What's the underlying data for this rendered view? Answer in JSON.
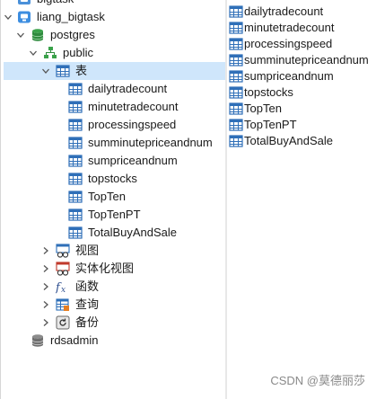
{
  "tree": {
    "top_partial": "bigtask",
    "connection": "liang_bigtask",
    "database": "postgres",
    "schema": "public",
    "tables_folder": "表",
    "tables": [
      "dailytradecount",
      "minutetradecount",
      "processingspeed",
      "summinutepriceandnum",
      "sumpriceandnum",
      "topstocks",
      "TopTen",
      "TopTenPT",
      "TotalBuyAndSale"
    ],
    "folders": [
      "视图",
      "实体化视图",
      "函数",
      "查询",
      "备份"
    ],
    "other_db": "rdsadmin"
  },
  "list": {
    "items": [
      "dailytradecount",
      "minutetradecount",
      "processingspeed",
      "summinutepriceandnum",
      "sumpriceandnum",
      "topstocks",
      "TopTen",
      "TopTenPT",
      "TotalBuyAndSale"
    ]
  },
  "watermark": "CSDN @莫德丽莎",
  "colors": {
    "selection": "#cfe6fb",
    "table_icon": "#2f6fb8",
    "db_icon": "#3aa24a"
  },
  "icons": {
    "table": "table-icon",
    "database": "database-icon",
    "schema": "schema-icon",
    "connection": "connection-icon",
    "view": "view-icon",
    "materialized_view": "materialized-view-icon",
    "function": "function-icon",
    "query": "query-icon",
    "backup": "backup-icon"
  }
}
